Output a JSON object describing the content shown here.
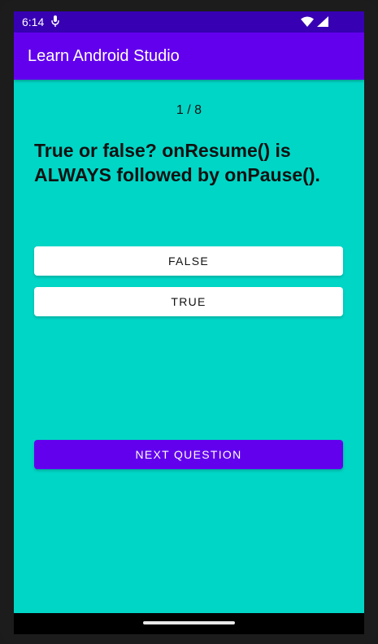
{
  "status_bar": {
    "time": "6:14",
    "icons": [
      "mic-icon",
      "wifi-icon",
      "signal-icon"
    ]
  },
  "app_bar": {
    "title": "Learn Android Studio"
  },
  "quiz": {
    "counter": "1 / 8",
    "question": "True or false? onResume() is ALWAYS followed by onPause().",
    "false_label": "FALSE",
    "true_label": "TRUE",
    "next_label": "NEXT QUESTION"
  },
  "colors": {
    "status_bar": "#3700b3",
    "app_bar": "#6200ee",
    "background": "#00d6c6",
    "button": "#ffffff",
    "accent": "#6200ee"
  }
}
